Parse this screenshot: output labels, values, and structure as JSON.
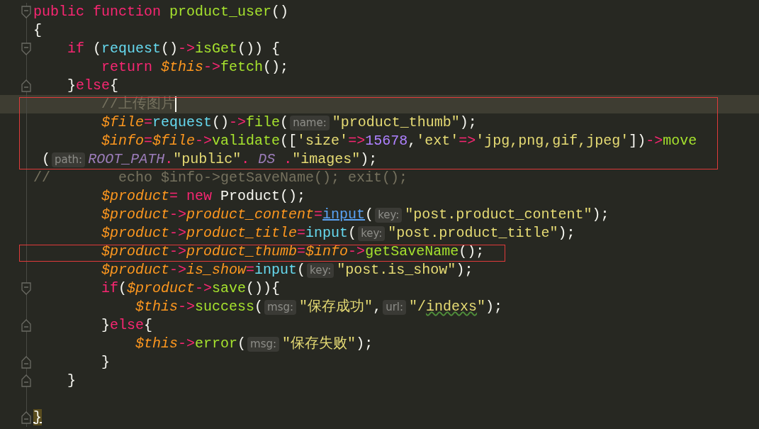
{
  "editor": {
    "lines": [
      {
        "fold_start": true,
        "current": false,
        "boxed": false,
        "tokens": [
          {
            "kind": "kw",
            "t": "public "
          },
          {
            "kind": "kw",
            "t": "function "
          },
          {
            "kind": "fn",
            "t": "product_user"
          },
          {
            "kind": "plain",
            "t": "()"
          }
        ]
      },
      {
        "current": false,
        "boxed": false,
        "tokens": [
          {
            "kind": "plain",
            "t": "{"
          }
        ]
      },
      {
        "fold_start": true,
        "current": false,
        "boxed": false,
        "tokens": [
          {
            "kind": "kw",
            "t": "    if"
          },
          {
            "kind": "plain",
            "t": " ("
          },
          {
            "kind": "call",
            "t": "request"
          },
          {
            "kind": "plain",
            "t": "()"
          },
          {
            "kind": "op",
            "t": "->"
          },
          {
            "kind": "fn",
            "t": "isGet"
          },
          {
            "kind": "plain",
            "t": "()) {"
          }
        ]
      },
      {
        "current": false,
        "boxed": false,
        "tokens": [
          {
            "kind": "kw",
            "t": "        return "
          },
          {
            "kind": "var",
            "t": "$this"
          },
          {
            "kind": "op",
            "t": "->"
          },
          {
            "kind": "fn",
            "t": "fetch"
          },
          {
            "kind": "plain",
            "t": "();"
          }
        ]
      },
      {
        "fold_end": true,
        "current": false,
        "boxed": false,
        "tokens": [
          {
            "kind": "plain",
            "t": "    }"
          },
          {
            "kind": "kw",
            "t": "else"
          },
          {
            "kind": "plain",
            "t": "{"
          }
        ]
      },
      {
        "current": true,
        "cursor": true,
        "boxed": true,
        "tokens": [
          {
            "kind": "cm",
            "t": "        //上传图片"
          }
        ]
      },
      {
        "current": false,
        "boxed": true,
        "tokens": [
          {
            "kind": "var",
            "t": "        $file"
          },
          {
            "kind": "op",
            "t": "="
          },
          {
            "kind": "call",
            "t": "request"
          },
          {
            "kind": "plain",
            "t": "()"
          },
          {
            "kind": "op",
            "t": "->"
          },
          {
            "kind": "fn",
            "t": "file"
          },
          {
            "kind": "plain",
            "t": "("
          },
          {
            "kind": "hint",
            "t": "name:"
          },
          {
            "kind": "str",
            "t": "\"product_thumb\""
          },
          {
            "kind": "plain",
            "t": ");"
          }
        ]
      },
      {
        "current": false,
        "boxed": true,
        "tokens": [
          {
            "kind": "var",
            "t": "        $info"
          },
          {
            "kind": "op",
            "t": "="
          },
          {
            "kind": "var",
            "t": "$file"
          },
          {
            "kind": "op",
            "t": "->"
          },
          {
            "kind": "fn",
            "t": "validate"
          },
          {
            "kind": "plain",
            "t": "(["
          },
          {
            "kind": "str",
            "t": "'size'"
          },
          {
            "kind": "op",
            "t": "=>"
          },
          {
            "kind": "num",
            "t": "15678"
          },
          {
            "kind": "plain",
            "t": ","
          },
          {
            "kind": "str",
            "t": "'ext'"
          },
          {
            "kind": "op",
            "t": "=>"
          },
          {
            "kind": "str",
            "t": "'jpg,png,gif,jpeg'"
          },
          {
            "kind": "plain",
            "t": "])"
          },
          {
            "kind": "op",
            "t": "->"
          },
          {
            "kind": "fn",
            "t": "move"
          }
        ]
      },
      {
        "current": false,
        "boxed": true,
        "tokens": [
          {
            "kind": "plain",
            "t": " ("
          },
          {
            "kind": "hint",
            "t": "path:"
          },
          {
            "kind": "const",
            "t": "ROOT_PATH"
          },
          {
            "kind": "op",
            "t": "."
          },
          {
            "kind": "str",
            "t": "\"public\""
          },
          {
            "kind": "op",
            "t": ". "
          },
          {
            "kind": "const",
            "t": "DS "
          },
          {
            "kind": "op",
            "t": "."
          },
          {
            "kind": "str",
            "t": "\"images\""
          },
          {
            "kind": "plain",
            "t": ");"
          }
        ]
      },
      {
        "current": false,
        "boxed": false,
        "tokens": [
          {
            "kind": "cm",
            "t": "//        echo $info->getSaveName(); exit();"
          }
        ]
      },
      {
        "current": false,
        "boxed": false,
        "tokens": [
          {
            "kind": "var",
            "t": "        $product"
          },
          {
            "kind": "op",
            "t": "= "
          },
          {
            "kind": "kw",
            "t": "new"
          },
          {
            "kind": "plain",
            "t": " Product();"
          }
        ]
      },
      {
        "current": false,
        "boxed": false,
        "tokens": [
          {
            "kind": "var",
            "t": "        $product"
          },
          {
            "kind": "op",
            "t": "->"
          },
          {
            "kind": "var",
            "t": "product_content"
          },
          {
            "kind": "op",
            "t": "="
          },
          {
            "kind": "link",
            "t": "input"
          },
          {
            "kind": "plain",
            "t": "("
          },
          {
            "kind": "hint",
            "t": "key:"
          },
          {
            "kind": "str",
            "t": "\"post.product_content\""
          },
          {
            "kind": "plain",
            "t": ");"
          }
        ]
      },
      {
        "current": false,
        "boxed": false,
        "tokens": [
          {
            "kind": "var",
            "t": "        $product"
          },
          {
            "kind": "op",
            "t": "->"
          },
          {
            "kind": "var",
            "t": "product_title"
          },
          {
            "kind": "op",
            "t": "="
          },
          {
            "kind": "call",
            "t": "input"
          },
          {
            "kind": "plain",
            "t": "("
          },
          {
            "kind": "hint",
            "t": "key:"
          },
          {
            "kind": "str",
            "t": "\"post.product_title\""
          },
          {
            "kind": "plain",
            "t": ");"
          }
        ]
      },
      {
        "current": false,
        "boxed": true,
        "tokens": [
          {
            "kind": "var",
            "t": "        $product"
          },
          {
            "kind": "op",
            "t": "->"
          },
          {
            "kind": "var",
            "t": "product_thumb"
          },
          {
            "kind": "op",
            "t": "="
          },
          {
            "kind": "var",
            "t": "$info"
          },
          {
            "kind": "op",
            "t": "->"
          },
          {
            "kind": "fn",
            "t": "getSaveName"
          },
          {
            "kind": "plain",
            "t": "();"
          }
        ]
      },
      {
        "current": false,
        "boxed": false,
        "tokens": [
          {
            "kind": "var",
            "t": "        $product"
          },
          {
            "kind": "op",
            "t": "->"
          },
          {
            "kind": "var",
            "t": "is_show"
          },
          {
            "kind": "op",
            "t": "="
          },
          {
            "kind": "call",
            "t": "input"
          },
          {
            "kind": "plain",
            "t": "("
          },
          {
            "kind": "hint",
            "t": "key:"
          },
          {
            "kind": "str",
            "t": "\"post.is_show\""
          },
          {
            "kind": "plain",
            "t": ");"
          }
        ]
      },
      {
        "fold_start": true,
        "current": false,
        "boxed": false,
        "tokens": [
          {
            "kind": "kw",
            "t": "        if"
          },
          {
            "kind": "plain",
            "t": "("
          },
          {
            "kind": "var",
            "t": "$product"
          },
          {
            "kind": "op",
            "t": "->"
          },
          {
            "kind": "fn",
            "t": "save"
          },
          {
            "kind": "plain",
            "t": "()){"
          }
        ]
      },
      {
        "current": false,
        "boxed": false,
        "tokens": [
          {
            "kind": "var",
            "t": "            $this"
          },
          {
            "kind": "op",
            "t": "->"
          },
          {
            "kind": "fn",
            "t": "success"
          },
          {
            "kind": "plain",
            "t": "("
          },
          {
            "kind": "hint",
            "t": "msg:"
          },
          {
            "kind": "str",
            "t": "\"保存成功\""
          },
          {
            "kind": "plain",
            "t": ","
          },
          {
            "kind": "hint",
            "t": "url:"
          },
          {
            "kind": "str",
            "t": "\"/"
          },
          {
            "kind": "typo",
            "t": "indexs"
          },
          {
            "kind": "str",
            "t": "\""
          },
          {
            "kind": "plain",
            "t": ");"
          }
        ]
      },
      {
        "fold_end": true,
        "current": false,
        "boxed": false,
        "tokens": [
          {
            "kind": "plain",
            "t": "        }"
          },
          {
            "kind": "kw",
            "t": "else"
          },
          {
            "kind": "plain",
            "t": "{"
          }
        ]
      },
      {
        "current": false,
        "boxed": false,
        "tokens": [
          {
            "kind": "var",
            "t": "            $this"
          },
          {
            "kind": "op",
            "t": "->"
          },
          {
            "kind": "fn",
            "t": "error"
          },
          {
            "kind": "plain",
            "t": "("
          },
          {
            "kind": "hint",
            "t": "msg:"
          },
          {
            "kind": "str",
            "t": "\"保存失败\""
          },
          {
            "kind": "plain",
            "t": ");"
          }
        ]
      },
      {
        "fold_end": true,
        "current": false,
        "boxed": false,
        "tokens": [
          {
            "kind": "plain",
            "t": "        }"
          }
        ]
      },
      {
        "fold_end": true,
        "current": false,
        "boxed": false,
        "tokens": [
          {
            "kind": "plain",
            "t": "    }"
          }
        ]
      },
      {
        "current": false,
        "boxed": false
      },
      {
        "fold_end": true,
        "current": false,
        "boxed": false,
        "tokens": [
          {
            "kind": "match",
            "t": "}"
          }
        ]
      }
    ]
  }
}
